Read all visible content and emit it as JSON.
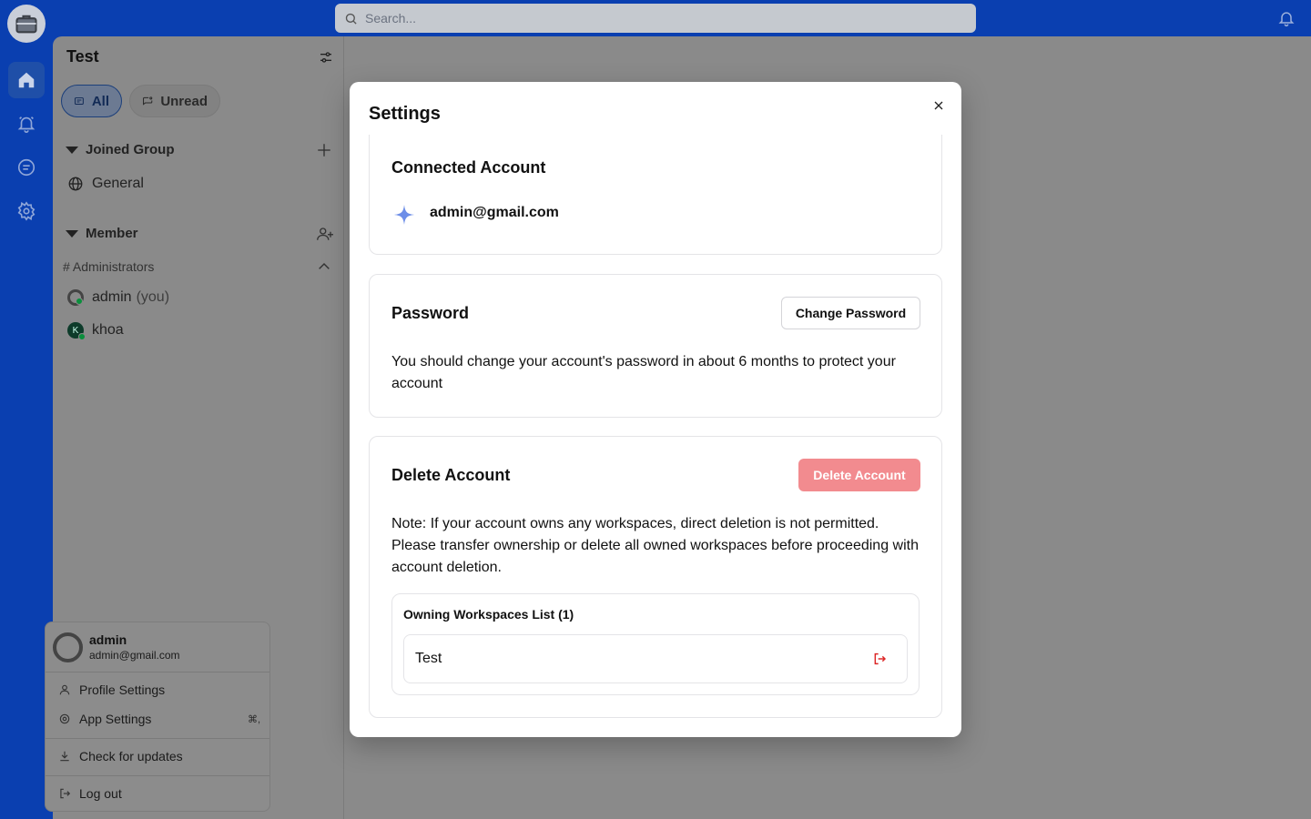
{
  "search": {
    "placeholder": "Search..."
  },
  "sidebar": {
    "workspace_title": "Test",
    "filters": {
      "all": "All",
      "unread": "Unread"
    },
    "joined_group": {
      "label": "Joined Group",
      "items": [
        "General"
      ]
    },
    "member": {
      "label": "Member",
      "subgroup": "# Administrators",
      "members": [
        {
          "name": "admin",
          "suffix": "(you)"
        },
        {
          "name": "khoa",
          "initial": "K"
        }
      ]
    }
  },
  "user_menu": {
    "name": "admin",
    "email": "admin@gmail.com",
    "items": {
      "profile": "Profile Settings",
      "app": "App Settings",
      "app_shortcut": "⌘,",
      "updates": "Check for updates",
      "logout": "Log out"
    }
  },
  "modal": {
    "title": "Settings",
    "connected": {
      "title": "Connected Account",
      "email": "admin@gmail.com"
    },
    "password": {
      "title": "Password",
      "button": "Change Password",
      "text": "You should change your account's password in about 6 months to protect your account"
    },
    "delete": {
      "title": "Delete Account",
      "button": "Delete Account",
      "text": "Note: If your account owns any workspaces, direct deletion is not permitted. Please transfer ownership or delete all owned workspaces before proceeding with account deletion.",
      "list_title": "Owning Workspaces List (1)",
      "workspaces": [
        "Test"
      ]
    }
  },
  "colors": {
    "brand": "#0a3fb0",
    "danger": "#f28b8f",
    "leave_icon": "#dc2626"
  }
}
